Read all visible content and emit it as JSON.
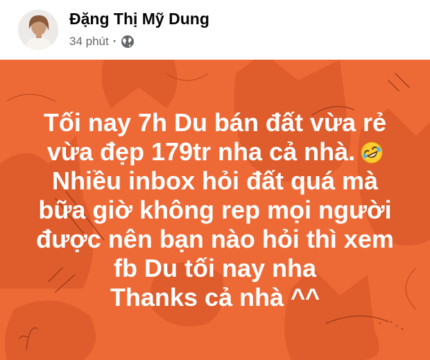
{
  "post": {
    "author": "Đặng Thị Mỹ Dung",
    "time": "34 phút",
    "separator": "·",
    "privacy_icon": "globe-icon",
    "lines": [
      "Tối nay 7h Du bán đất vừa rẻ",
      "vừa đẹp 179tr nha cả nhà.",
      "Nhiều inbox hỏi đất quá mà",
      "bữa giờ không rep mọi người",
      "được nên bạn nào hỏi thì xem",
      "fb Du tối nay nha",
      "Thanks cả nhà ^^"
    ],
    "emoji_icon": "rolling-laughing-emoji-icon",
    "background_color": "#ed6a37",
    "text_color": "#ffffff"
  }
}
